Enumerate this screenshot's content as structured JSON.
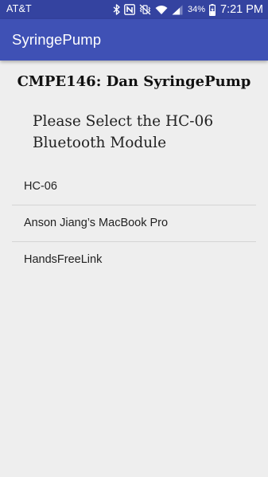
{
  "status_bar": {
    "carrier": "AT&T",
    "battery_percent": "34%",
    "time": "7:21 PM",
    "icons": [
      "bluetooth-icon",
      "nfc-icon",
      "vibrate-mute-icon",
      "wifi-icon",
      "cell-signal-icon",
      "battery-charging-icon"
    ]
  },
  "app_bar": {
    "title": "SyringePump",
    "color": "#3f51b5"
  },
  "main": {
    "heading": "CMPE146: Dan SyringePump",
    "prompt": "Please Select the HC-06 Bluetooth Module",
    "devices": [
      {
        "label": "HC-06"
      },
      {
        "label": "Anson Jiang’s MacBook Pro"
      },
      {
        "label": "HandsFreeLink"
      }
    ]
  }
}
